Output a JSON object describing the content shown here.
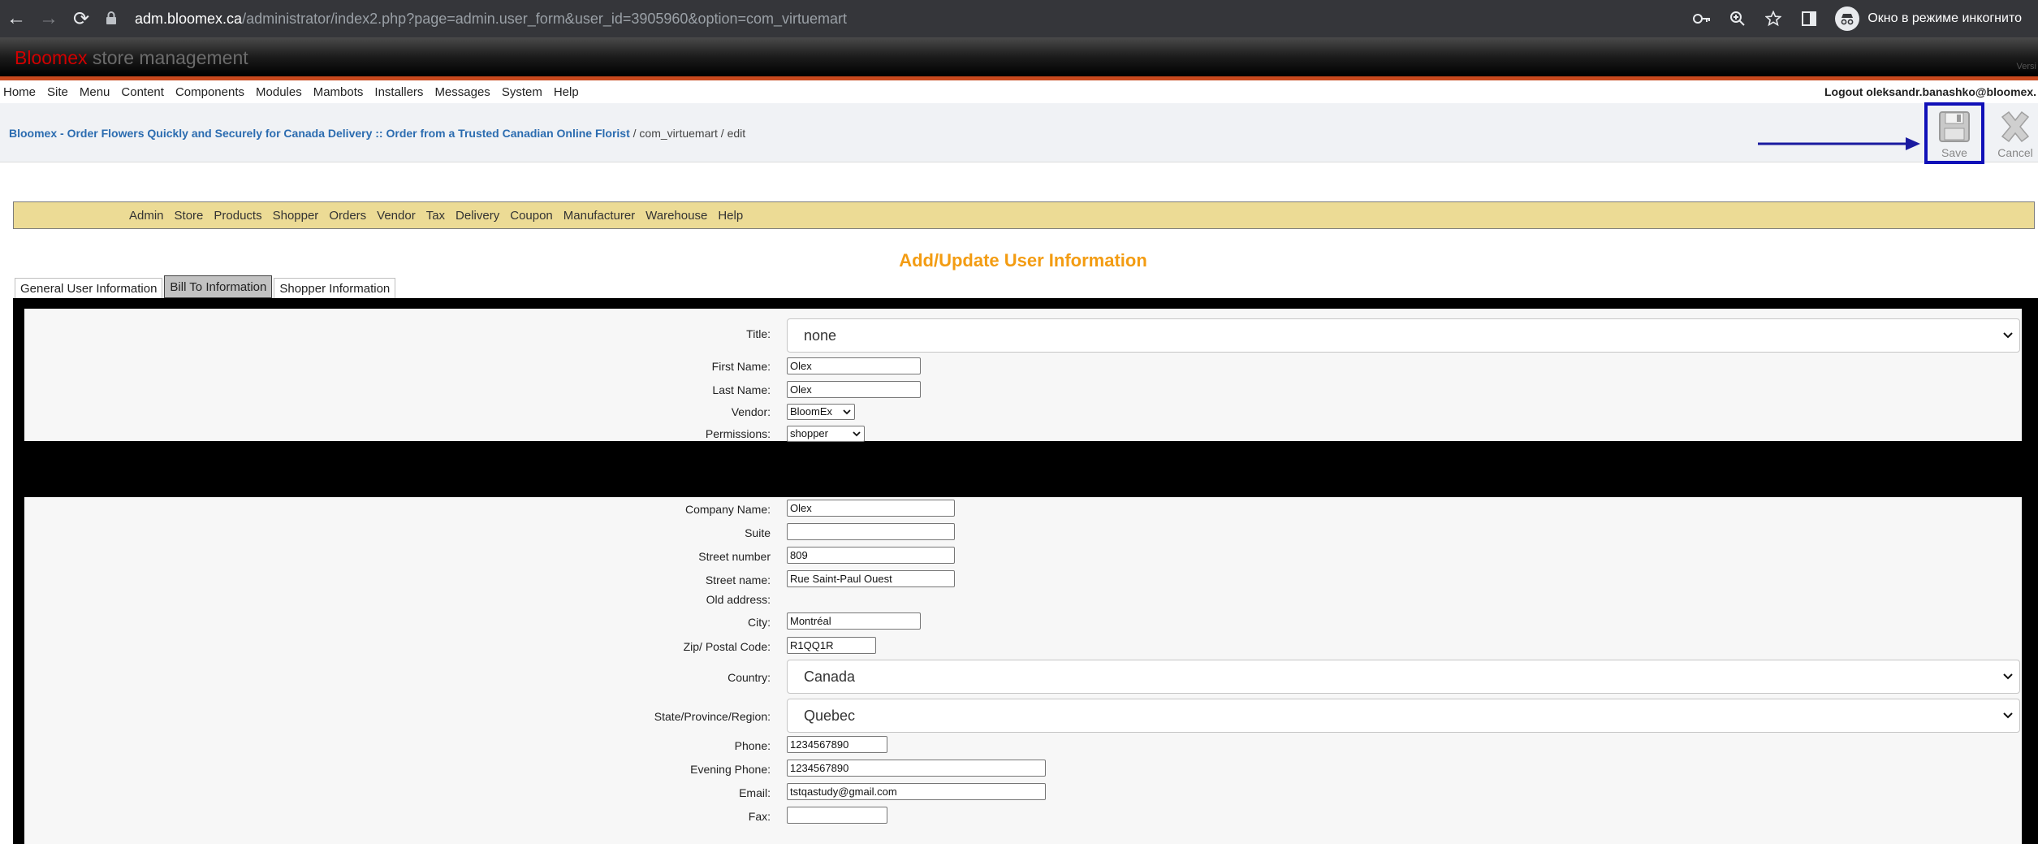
{
  "browser": {
    "back_icon": "←",
    "forward_icon": "→",
    "reload_icon": "⟳",
    "url_host": "adm.bloomex.ca",
    "url_path": "/administrator/index2.php?page=admin.user_form&user_id=3905960&option=com_virtuemart",
    "incognito_label": "Окно в режиме инкогнито"
  },
  "header": {
    "brand_red": "Bloomex",
    "brand_gray": " store management",
    "version": "Versi"
  },
  "top_menu": {
    "items": [
      "Home",
      "Site",
      "Menu",
      "Content",
      "Components",
      "Modules",
      "Mambots",
      "Installers",
      "Messages",
      "System",
      "Help"
    ],
    "logout": "Logout oleksandr.banashko@bloomex."
  },
  "pathway": {
    "site_link": "Bloomex - Order Flowers Quickly and Securely for Canada Delivery :: Order from a Trusted Canadian Online Florist",
    "rest": " / com_virtuemart / edit"
  },
  "toolbar": {
    "save_label": "Save",
    "cancel_label": "Cancel"
  },
  "vm_menu": {
    "items": [
      "Admin",
      "Store",
      "Products",
      "Shopper",
      "Orders",
      "Vendor",
      "Tax",
      "Delivery",
      "Coupon",
      "Manufacturer",
      "Warehouse",
      "Help"
    ]
  },
  "form": {
    "title": "Add/Update User Information",
    "tabs": [
      "General User Information",
      "Bill To Information",
      "Shopper Information"
    ],
    "general": {
      "title_label": "Title:",
      "title_value": "none",
      "first_name_label": "First Name:",
      "first_name_value": "Olex",
      "last_name_label": "Last Name:",
      "last_name_value": "Olex",
      "vendor_label": "Vendor:",
      "vendor_value": "BloomEx",
      "permissions_label": "Permissions:",
      "permissions_value": "shopper"
    },
    "bill": {
      "company_label": "Company Name:",
      "company_value": "Olex",
      "suite_label": "Suite",
      "suite_value": "",
      "street_number_label": "Street number",
      "street_number_value": "809",
      "street_name_label": "Street name:",
      "street_name_value": "Rue Saint-Paul Ouest",
      "old_address_label": "Old address:",
      "city_label": "City:",
      "city_value": "Montréal",
      "zip_label": "Zip/ Postal Code:",
      "zip_value": "R1QQ1R",
      "country_label": "Country:",
      "country_value": "Canada",
      "state_label": "State/Province/Region:",
      "state_value": "Quebec",
      "phone_label": "Phone:",
      "phone_value": "1234567890",
      "evening_phone_label": "Evening Phone:",
      "evening_phone_value": "1234567890",
      "email_label": "Email:",
      "email_value": "tstqastudy@gmail.com",
      "fax_label": "Fax:",
      "fax_value": ""
    }
  },
  "colors": {
    "brand_red": "#d00000",
    "accent_orange": "#f39c12",
    "menu_bar": "#ecdb95",
    "highlight_blue": "#1010b8"
  }
}
